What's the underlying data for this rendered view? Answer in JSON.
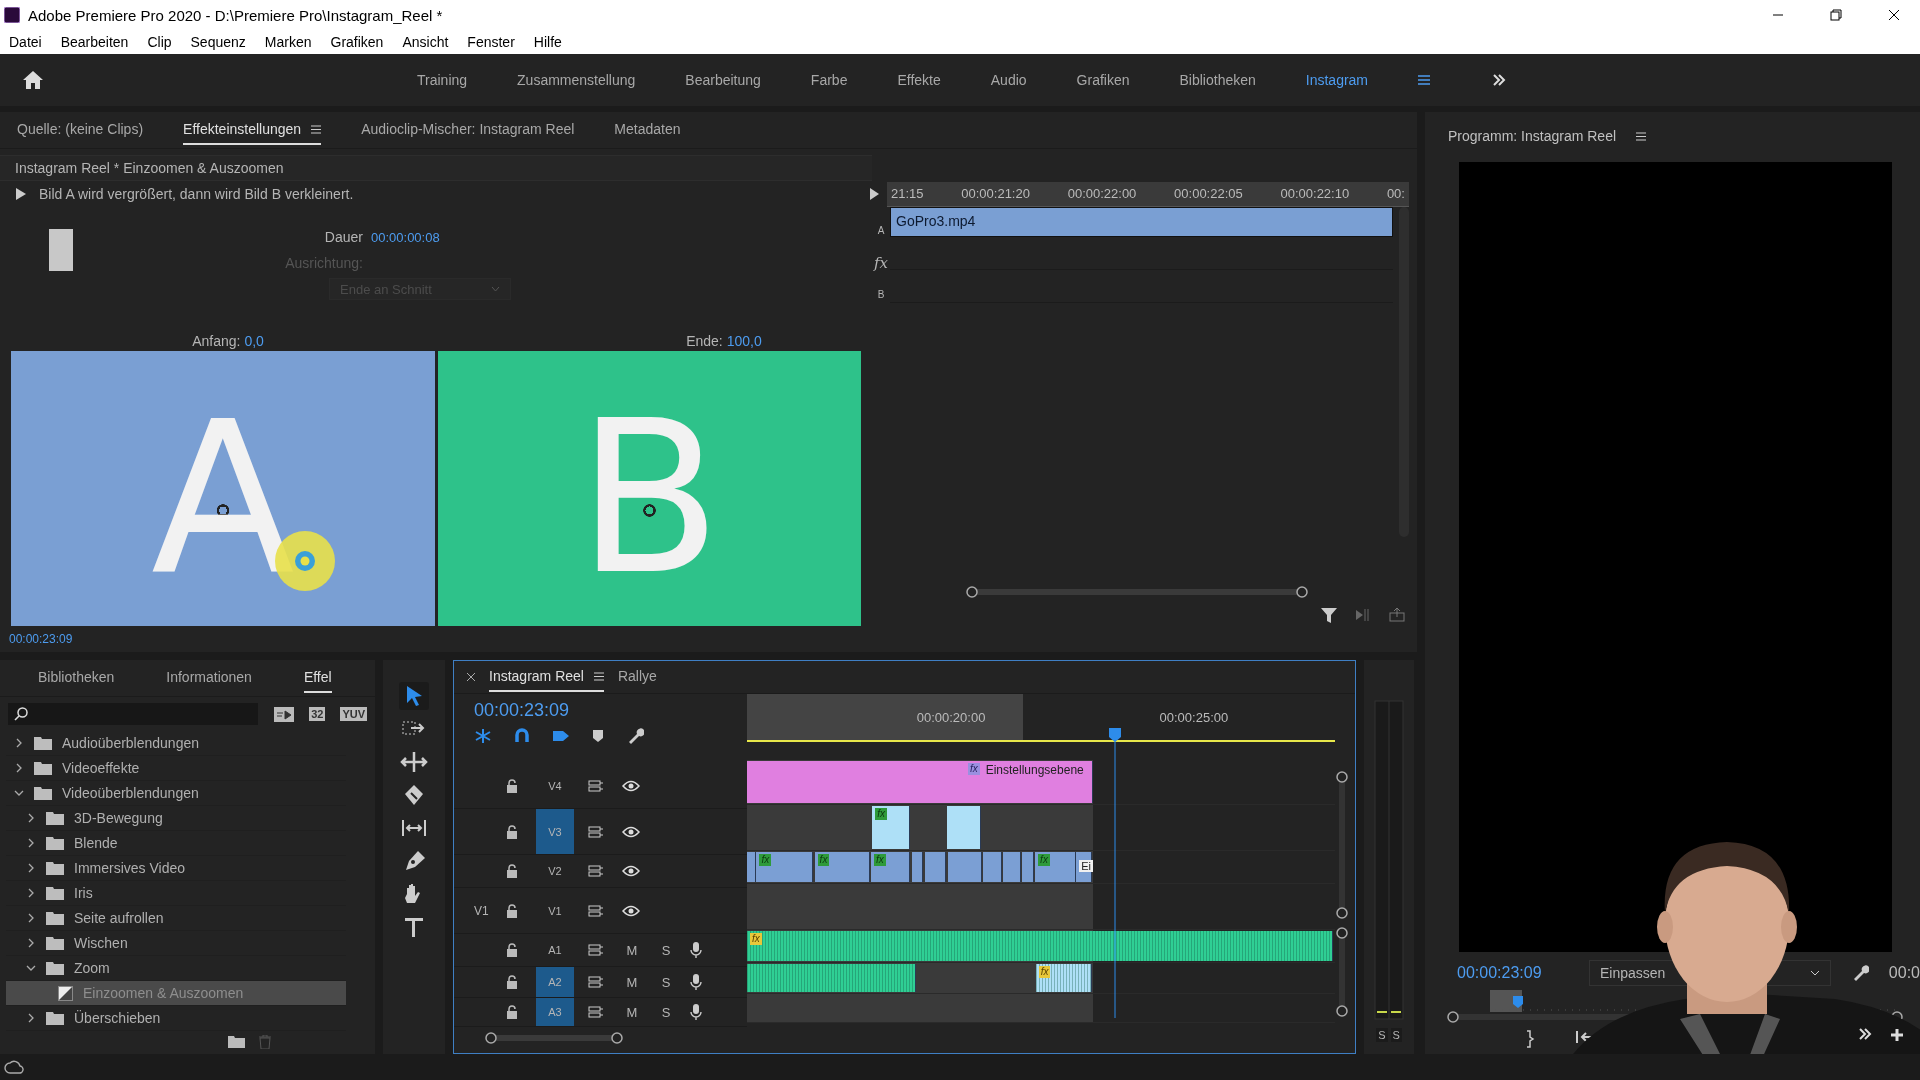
{
  "window": {
    "title": "Adobe Premiere Pro 2020 - D:\\Premiere Pro\\Instagram_Reel *"
  },
  "menu": [
    "Datei",
    "Bearbeiten",
    "Clip",
    "Sequenz",
    "Marken",
    "Grafiken",
    "Ansicht",
    "Fenster",
    "Hilfe"
  ],
  "workspaces": [
    {
      "label": "Training",
      "selected": false
    },
    {
      "label": "Zusammenstellung",
      "selected": false
    },
    {
      "label": "Bearbeitung",
      "selected": false
    },
    {
      "label": "Farbe",
      "selected": false
    },
    {
      "label": "Effekte",
      "selected": false
    },
    {
      "label": "Audio",
      "selected": false
    },
    {
      "label": "Grafiken",
      "selected": false
    },
    {
      "label": "Bibliotheken",
      "selected": false
    },
    {
      "label": "Instagram",
      "selected": true
    }
  ],
  "effect_controls": {
    "tabs": [
      {
        "label": "Quelle: (keine Clips)",
        "selected": false
      },
      {
        "label": "Effekteinstellungen",
        "selected": true
      },
      {
        "label": "Audioclip-Mischer: Instagram Reel",
        "selected": false
      },
      {
        "label": "Metadaten",
        "selected": false
      }
    ],
    "clip_title": "Instagram Reel * Einzoomen & Auszoomen",
    "description": "Bild A wird vergrößert, dann wird Bild B verkleinert.",
    "duration_label": "Dauer",
    "duration": "00:00:00:08",
    "alignment_label": "Ausrichtung:",
    "alignment": "Ende an Schnitt",
    "start_label": "Anfang:",
    "start": "0,0",
    "end_label": "Ende:",
    "end": "100,0",
    "preview_a": "A",
    "preview_b": "B",
    "timecode": "00:00:23:09",
    "mini_timeline": {
      "ticks": [
        "21:15",
        "00:00:21:20",
        "00:00:22:00",
        "00:00:22:05",
        "00:00:22:10",
        "00:"
      ],
      "track_labels": [
        "A",
        "fx",
        "B"
      ],
      "clip": "GoPro3.mp4"
    }
  },
  "effects_panel": {
    "tabs": [
      {
        "label": "Bibliotheken",
        "selected": false
      },
      {
        "label": "Informationen",
        "selected": false
      },
      {
        "label": "Effel",
        "selected": true
      }
    ],
    "badges": [
      "32",
      "YUV"
    ],
    "tree": [
      {
        "label": "Audioüberblendungen",
        "kind": "folder",
        "expanded": false
      },
      {
        "label": "Videoeffekte",
        "kind": "folder",
        "expanded": false
      },
      {
        "label": "Videoüberblendungen",
        "kind": "folder",
        "expanded": true,
        "children": [
          {
            "label": "3D-Bewegung",
            "kind": "folder",
            "expanded": false
          },
          {
            "label": "Blende",
            "kind": "folder",
            "expanded": false
          },
          {
            "label": "Immersives Video",
            "kind": "folder",
            "expanded": false
          },
          {
            "label": "Iris",
            "kind": "folder",
            "expanded": false
          },
          {
            "label": "Seite aufrollen",
            "kind": "folder",
            "expanded": false
          },
          {
            "label": "Wischen",
            "kind": "folder",
            "expanded": false
          },
          {
            "label": "Zoom",
            "kind": "folder",
            "expanded": true,
            "children": [
              {
                "label": "Einzoomen & Auszoomen",
                "kind": "effect",
                "selected": true
              }
            ]
          },
          {
            "label": "Überschieben",
            "kind": "folder",
            "expanded": false
          }
        ]
      }
    ]
  },
  "timeline": {
    "tabs": [
      {
        "label": "Instagram Reel",
        "selected": true
      },
      {
        "label": "Rallye",
        "selected": false
      }
    ],
    "timecode": "00:00:23:09",
    "ruler": [
      "00:00:20:00",
      "00:00:25:00"
    ],
    "tracks": [
      {
        "name": "V4",
        "kind": "video",
        "target": false,
        "clips": [
          {
            "kind": "adjustment",
            "label": "Einstellungsebene",
            "badge": "fx",
            "color": "#e07fe0"
          }
        ]
      },
      {
        "name": "V3",
        "kind": "video",
        "target": true,
        "clips": [
          {
            "kind": "video",
            "badge": "fx",
            "color": "#aee0f7"
          },
          {
            "kind": "video",
            "color": "#aee0f7"
          }
        ]
      },
      {
        "name": "V2",
        "kind": "video",
        "target": false,
        "clips": [
          {
            "kind": "video",
            "color": "#7b9fd4"
          },
          {
            "kind": "video",
            "badge": "fx",
            "color": "#7b9fd4"
          },
          {
            "kind": "video",
            "badge": "fx",
            "color": "#7b9fd4"
          },
          {
            "kind": "video",
            "badge": "fx",
            "color": "#7b9fd4"
          },
          {
            "kind": "video",
            "color": "#7b9fd4"
          },
          {
            "kind": "video",
            "color": "#7b9fd4"
          },
          {
            "kind": "video",
            "color": "#7b9fd4"
          },
          {
            "kind": "video",
            "color": "#7b9fd4"
          },
          {
            "kind": "video",
            "color": "#7b9fd4"
          },
          {
            "kind": "video",
            "color": "#7b9fd4"
          },
          {
            "kind": "video",
            "badge": "fx",
            "color": "#7b9fd4"
          },
          {
            "kind": "graphic",
            "label": "Ei",
            "color": "#7b9fd4"
          }
        ]
      },
      {
        "name": "V1",
        "kind": "video",
        "source": "V1",
        "target": false
      },
      {
        "name": "A1",
        "kind": "audio",
        "target": false,
        "buttons": [
          "M",
          "S"
        ],
        "clips": [
          {
            "kind": "audio",
            "badge": "fx",
            "color": "#2fcf94"
          }
        ]
      },
      {
        "name": "A2",
        "kind": "audio",
        "target": true,
        "buttons": [
          "M",
          "S"
        ],
        "clips": [
          {
            "kind": "audio",
            "color": "#2fcf94"
          },
          {
            "kind": "audio",
            "badge": "fx",
            "color": "#aee0f7"
          }
        ]
      },
      {
        "name": "A3",
        "kind": "audio",
        "target": true,
        "buttons": [
          "M",
          "S"
        ]
      }
    ]
  },
  "meter_labels": [
    "S",
    "S"
  ],
  "program": {
    "title": "Programm: Instagram Reel",
    "timecode": "00:00:23:09",
    "zoom": "Einpassen",
    "duration": "00:0"
  }
}
